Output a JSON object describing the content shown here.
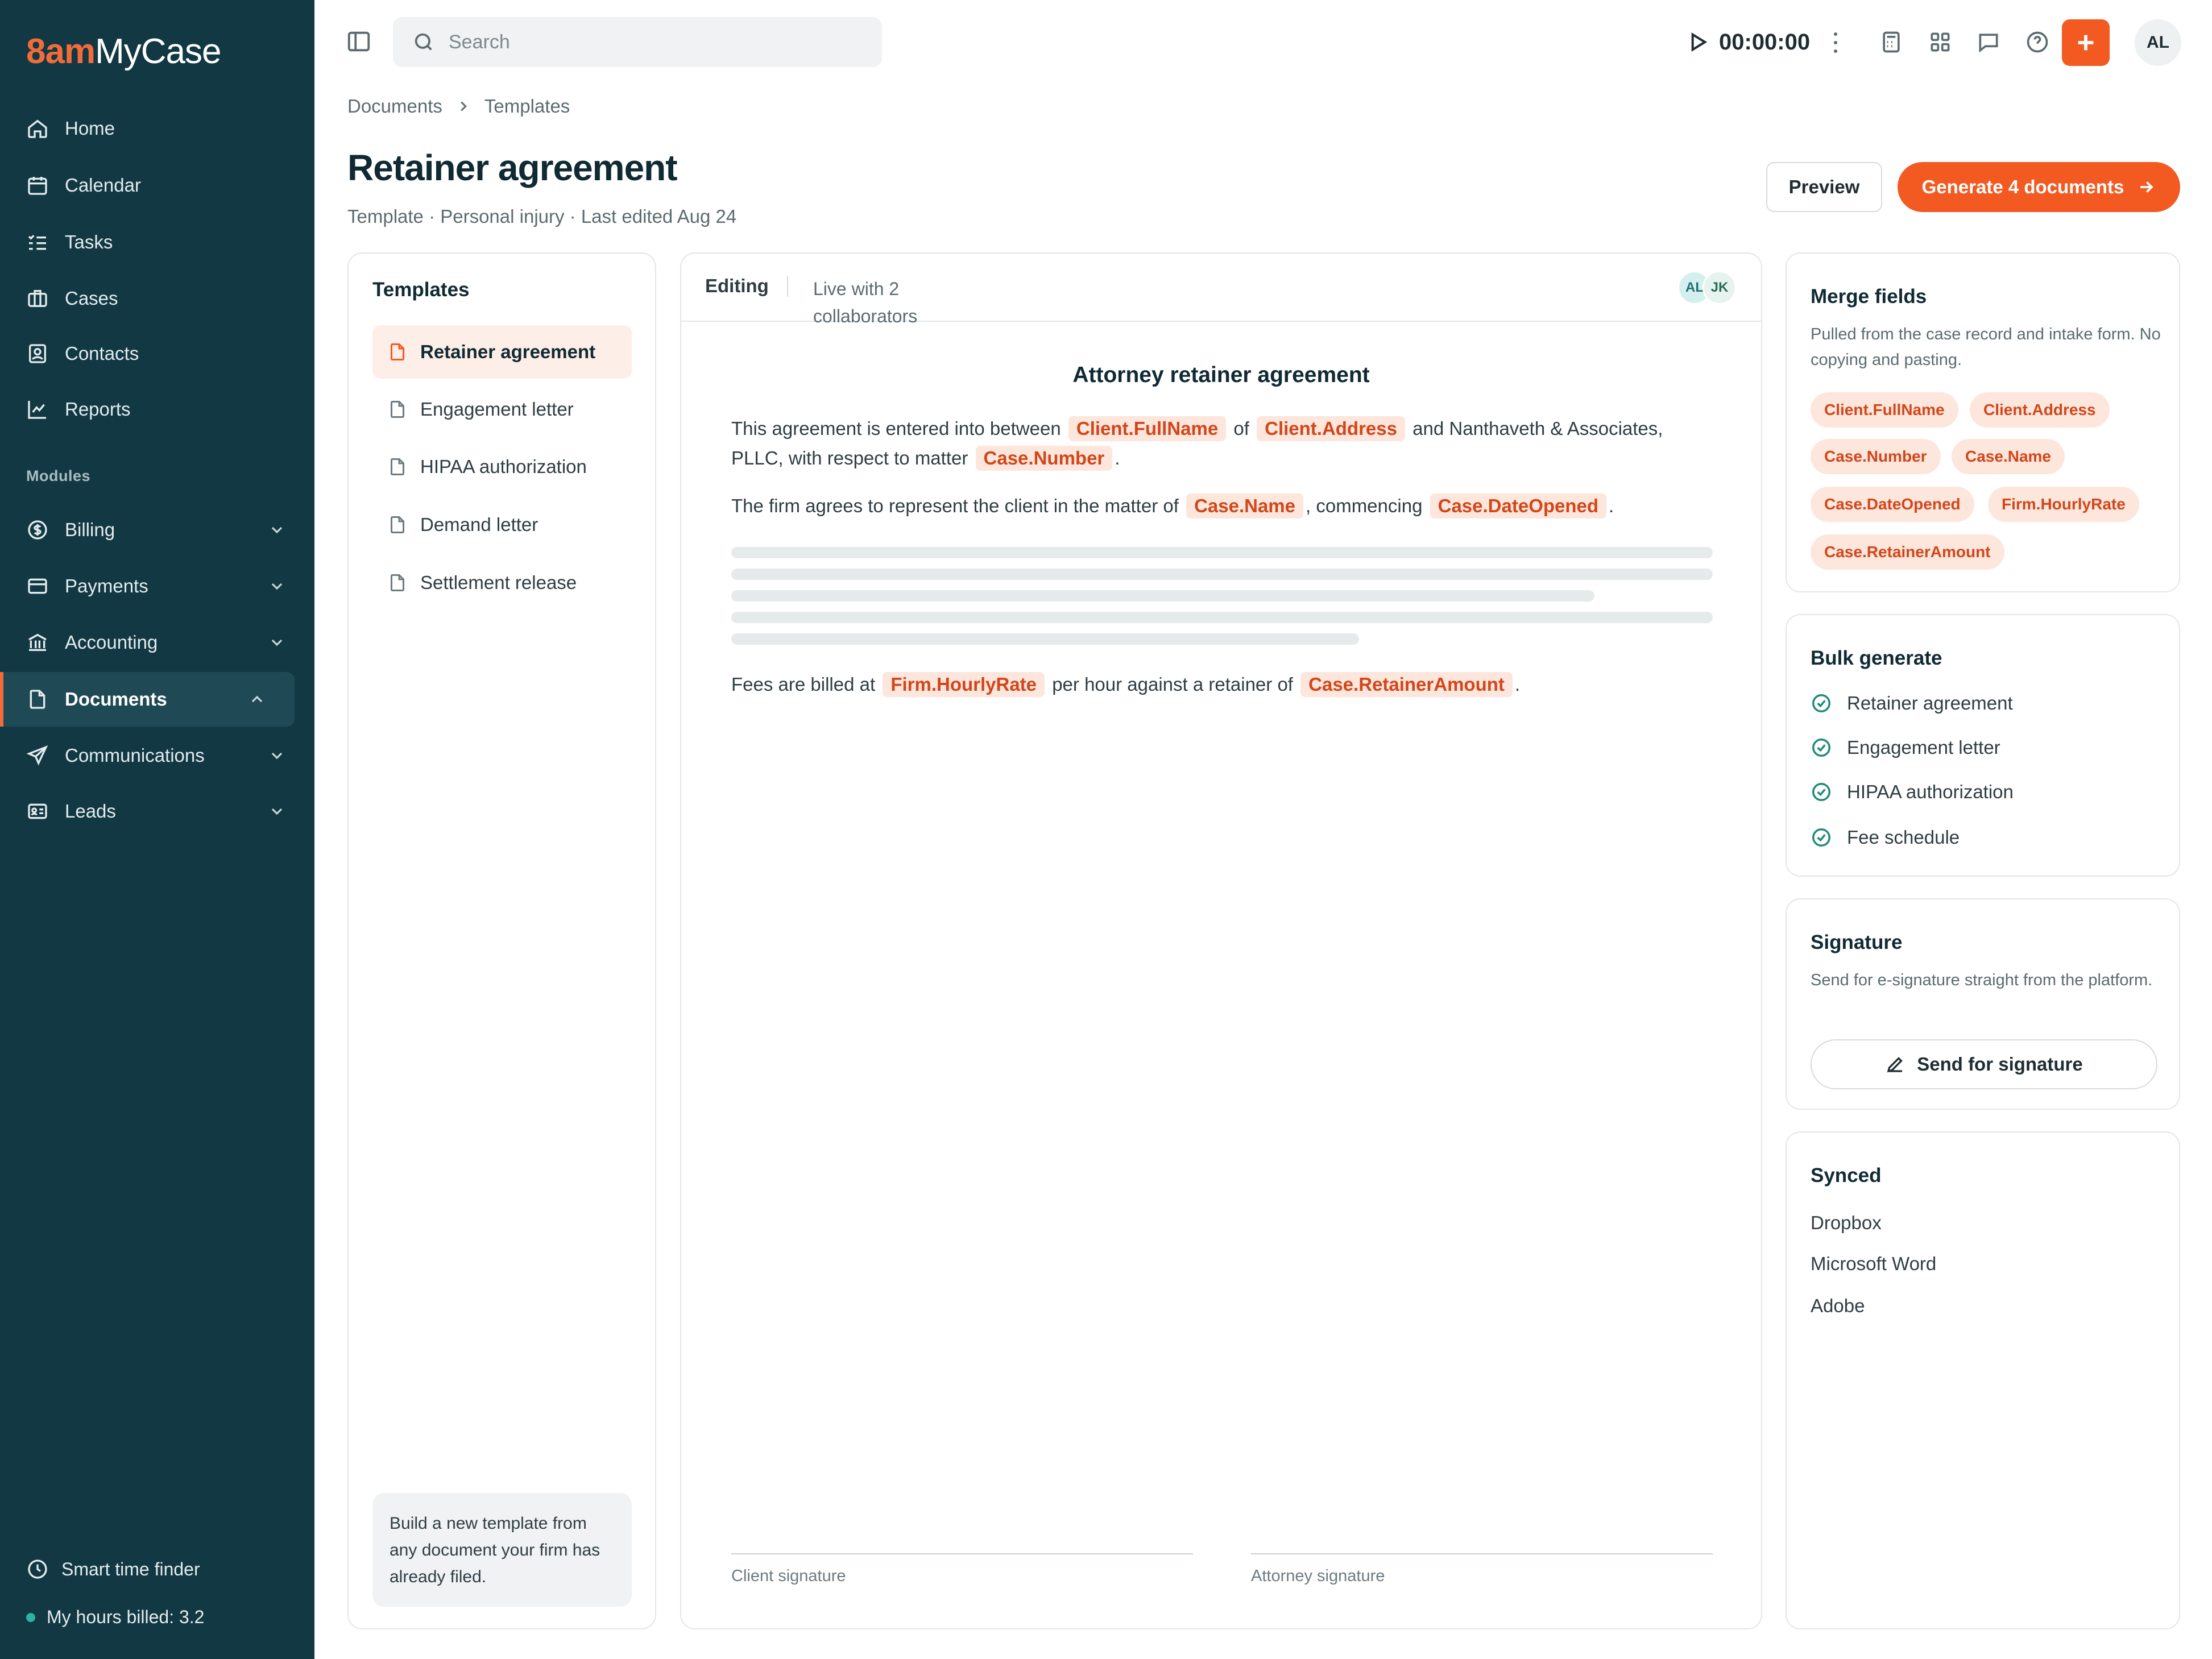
{
  "app": {
    "brand_prefix": "8am",
    "brand_name": "MyCase",
    "accent_color": "#f25a22",
    "sidebar_color": "#123843"
  },
  "sidebar": {
    "items": [
      {
        "label": "Home",
        "icon": "home-icon"
      },
      {
        "label": "Calendar",
        "icon": "calendar-icon"
      },
      {
        "label": "Tasks",
        "icon": "tasks-icon"
      },
      {
        "label": "Cases",
        "icon": "briefcase-icon"
      },
      {
        "label": "Contacts",
        "icon": "contacts-icon"
      },
      {
        "label": "Reports",
        "icon": "chart-line-icon"
      }
    ],
    "modules_label": "Modules",
    "modules": [
      {
        "label": "Billing",
        "icon": "dollar-icon",
        "expanded": false
      },
      {
        "label": "Payments",
        "icon": "credit-card-icon",
        "expanded": false
      },
      {
        "label": "Accounting",
        "icon": "bank-icon",
        "expanded": false
      },
      {
        "label": "Documents",
        "icon": "document-icon",
        "expanded": true,
        "active": true
      },
      {
        "label": "Communications",
        "icon": "send-icon",
        "expanded": false
      },
      {
        "label": "Leads",
        "icon": "id-card-icon",
        "expanded": false
      }
    ],
    "footer": {
      "time_finder": "Smart time finder",
      "hours_billed": "My hours billed: 3.2"
    }
  },
  "topbar": {
    "search_placeholder": "Search",
    "timer": "00:00:00",
    "icons": [
      "calculator-icon",
      "grid-icon",
      "chat-icon",
      "help-icon"
    ],
    "avatar_initials": "AL"
  },
  "breadcrumb": {
    "items": [
      "Documents",
      "Templates"
    ]
  },
  "page": {
    "title": "Retainer agreement",
    "subtitle": "Template · Personal injury · Last edited Aug 24",
    "preview_label": "Preview",
    "generate_label": "Generate 4 documents"
  },
  "templates": {
    "title": "Templates",
    "items": [
      "Retainer agreement",
      "Engagement letter",
      "HIPAA authorization",
      "Demand letter",
      "Settlement release"
    ],
    "active_index": 0,
    "hint": "Build a new template from any document your firm has already filed."
  },
  "editor": {
    "mode": "Editing",
    "live": "Live with 2 collaborators",
    "collaborators": [
      "AL",
      "JK"
    ],
    "doc_title": "Attorney retainer agreement",
    "p1": {
      "t1": "This agreement is entered into between",
      "f1": "Client.FullName",
      "t2": "of",
      "f2": "Client.Address",
      "t3": "and Nanthaveth & Associates, PLLC, with respect to matter",
      "f3": "Case.Number",
      "t4": "."
    },
    "p2": {
      "t1": "The firm agrees to represent the client in the matter of",
      "f1": "Case.Name",
      "t2": ", commencing",
      "f2": "Case.DateOpened",
      "t3": "."
    },
    "p3": {
      "t1": "Fees are billed at",
      "f1": "Firm.HourlyRate",
      "t2": "per hour against a retainer of",
      "f2": "Case.RetainerAmount",
      "t3": "."
    },
    "client_signature": "Client signature",
    "attorney_signature": "Attorney signature"
  },
  "merge_fields": {
    "title": "Merge fields",
    "desc": "Pulled from the case record and intake form. No copying and pasting.",
    "chips": [
      "Client.FullName",
      "Client.Address",
      "Case.Number",
      "Case.Name",
      "Case.DateOpened",
      "Firm.HourlyRate",
      "Case.RetainerAmount"
    ]
  },
  "bulk": {
    "title": "Bulk generate",
    "items": [
      "Retainer agreement",
      "Engagement letter",
      "HIPAA authorization",
      "Fee schedule"
    ]
  },
  "signature": {
    "title": "Signature",
    "desc": "Send for e-signature straight from the platform.",
    "button": "Send for signature"
  },
  "synced": {
    "title": "Synced",
    "items": [
      "Dropbox",
      "Microsoft Word",
      "Adobe"
    ]
  }
}
